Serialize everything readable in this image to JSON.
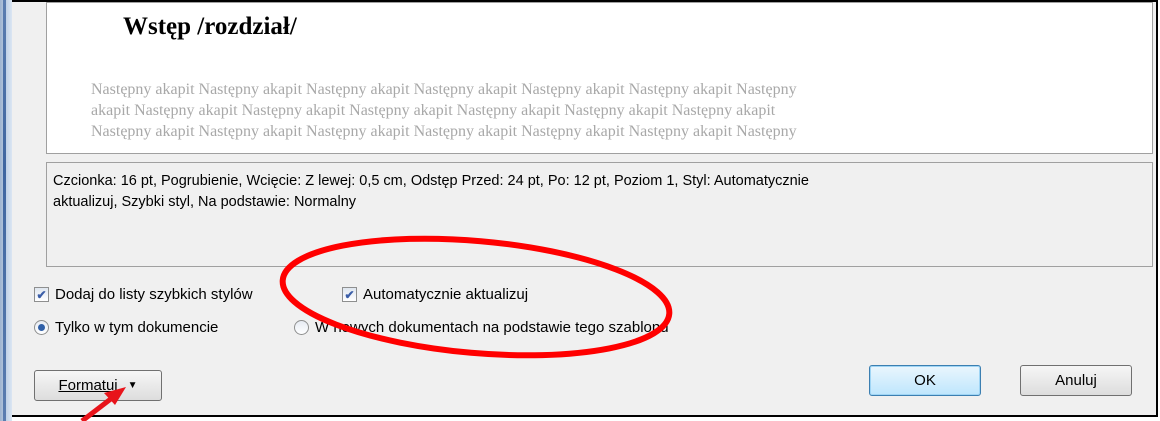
{
  "preview": {
    "heading": "Wstęp /rozdział/",
    "sample_lines": [
      "Następny akapit Następny akapit Następny akapit Następny akapit Następny akapit Następny akapit Następny",
      "akapit Następny akapit Następny akapit Następny akapit Następny akapit Następny akapit Następny akapit",
      "Następny akapit Następny akapit Następny akapit Następny akapit Następny akapit Następny akapit Następny"
    ]
  },
  "description": {
    "line1": "Czcionka: 16 pt, Pogrubienie, Wcięcie: Z lewej:  0,5 cm, Odstęp Przed:  24 pt, Po:  12 pt, Poziom 1, Styl: Automatycznie",
    "line2": "aktualizuj, Szybki styl, Na podstawie: Normalny"
  },
  "options": {
    "add_to_quick_styles": {
      "label": "Dodaj do listy szybkich stylów",
      "checked": true
    },
    "auto_update": {
      "label": "Automatycznie aktualizuj",
      "checked": true
    },
    "only_this_document": {
      "label": "Tylko w tym dokumencie",
      "selected": true
    },
    "new_documents": {
      "label": "W nowych dokumentach na podstawie tego szablonu",
      "selected": false
    }
  },
  "buttons": {
    "format": "Formatuj",
    "ok": "OK",
    "cancel": "Anuluj"
  },
  "annotation_colors": {
    "ellipse": "#ff0000",
    "arrow": "#e8141b"
  }
}
